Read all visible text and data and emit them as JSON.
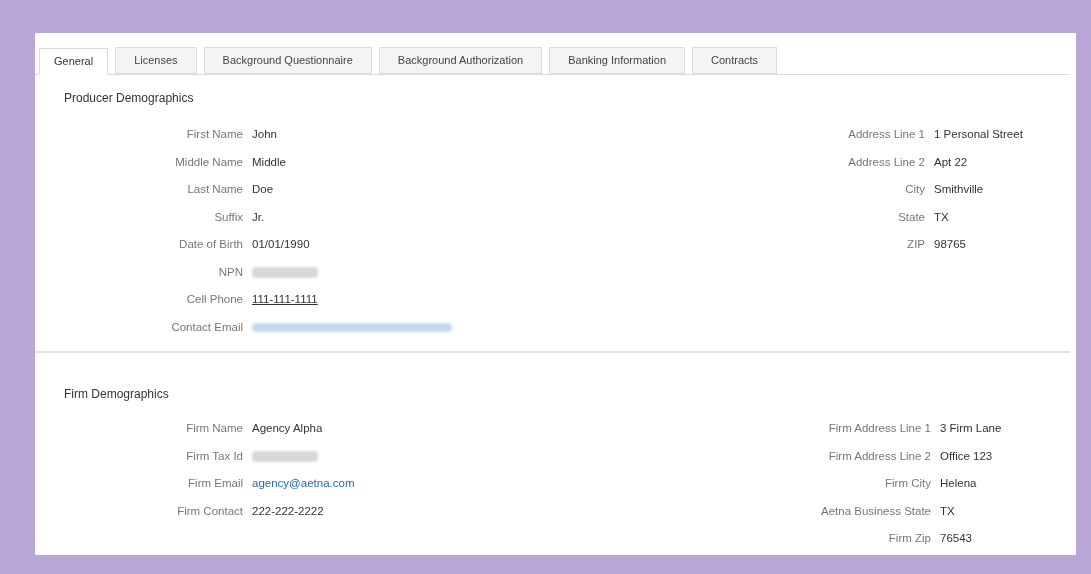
{
  "tabs": [
    {
      "label": "General",
      "selected": true
    },
    {
      "label": "Licenses",
      "selected": false
    },
    {
      "label": "Background Questionnaire",
      "selected": false
    },
    {
      "label": "Background Authorization",
      "selected": false
    },
    {
      "label": "Banking Information",
      "selected": false
    },
    {
      "label": "Contracts",
      "selected": false
    }
  ],
  "sections": [
    {
      "title": "Producer Demographics",
      "left": [
        {
          "label": "First Name",
          "value": "John",
          "kind": "text"
        },
        {
          "label": "Middle Name",
          "value": "Middle",
          "kind": "text"
        },
        {
          "label": "Last Name",
          "value": "Doe",
          "kind": "text"
        },
        {
          "label": "Suffix",
          "value": "Jr.",
          "kind": "text"
        },
        {
          "label": "Date of Birth",
          "value": "01/01/1990",
          "kind": "text"
        },
        {
          "label": "NPN",
          "kind": "redacted"
        },
        {
          "label": "Cell Phone",
          "value": "111-111-1111",
          "kind": "phone"
        },
        {
          "label": "Contact Email",
          "kind": "redacted_link"
        }
      ],
      "right": [
        {
          "label": "Address Line 1",
          "value": "1 Personal Street",
          "kind": "text"
        },
        {
          "label": "Address Line 2",
          "value": "Apt 22",
          "kind": "text"
        },
        {
          "label": "City",
          "value": "Smithville",
          "kind": "text"
        },
        {
          "label": "State",
          "value": "TX",
          "kind": "text"
        },
        {
          "label": "ZIP",
          "value": "98765",
          "kind": "text"
        }
      ]
    },
    {
      "title": "Firm Demographics",
      "left": [
        {
          "label": "Firm Name",
          "value": "Agency Alpha",
          "kind": "text"
        },
        {
          "label": "Firm Tax Id",
          "kind": "redacted"
        },
        {
          "label": "Firm Email",
          "value": "agency@aetna.com",
          "kind": "link"
        },
        {
          "label": "Firm Contact",
          "value": "222-222-2222",
          "kind": "text"
        }
      ],
      "right": [
        {
          "label": "Firm Address Line 1",
          "value": "3 Firm Lane",
          "kind": "text"
        },
        {
          "label": "Firm Address Line 2",
          "value": "Office 123",
          "kind": "text"
        },
        {
          "label": "Firm City",
          "value": "Helena",
          "kind": "text"
        },
        {
          "label": "Aetna Business State",
          "value": "TX",
          "kind": "text"
        },
        {
          "label": "Firm Zip",
          "value": "76543",
          "kind": "text"
        }
      ]
    }
  ]
}
